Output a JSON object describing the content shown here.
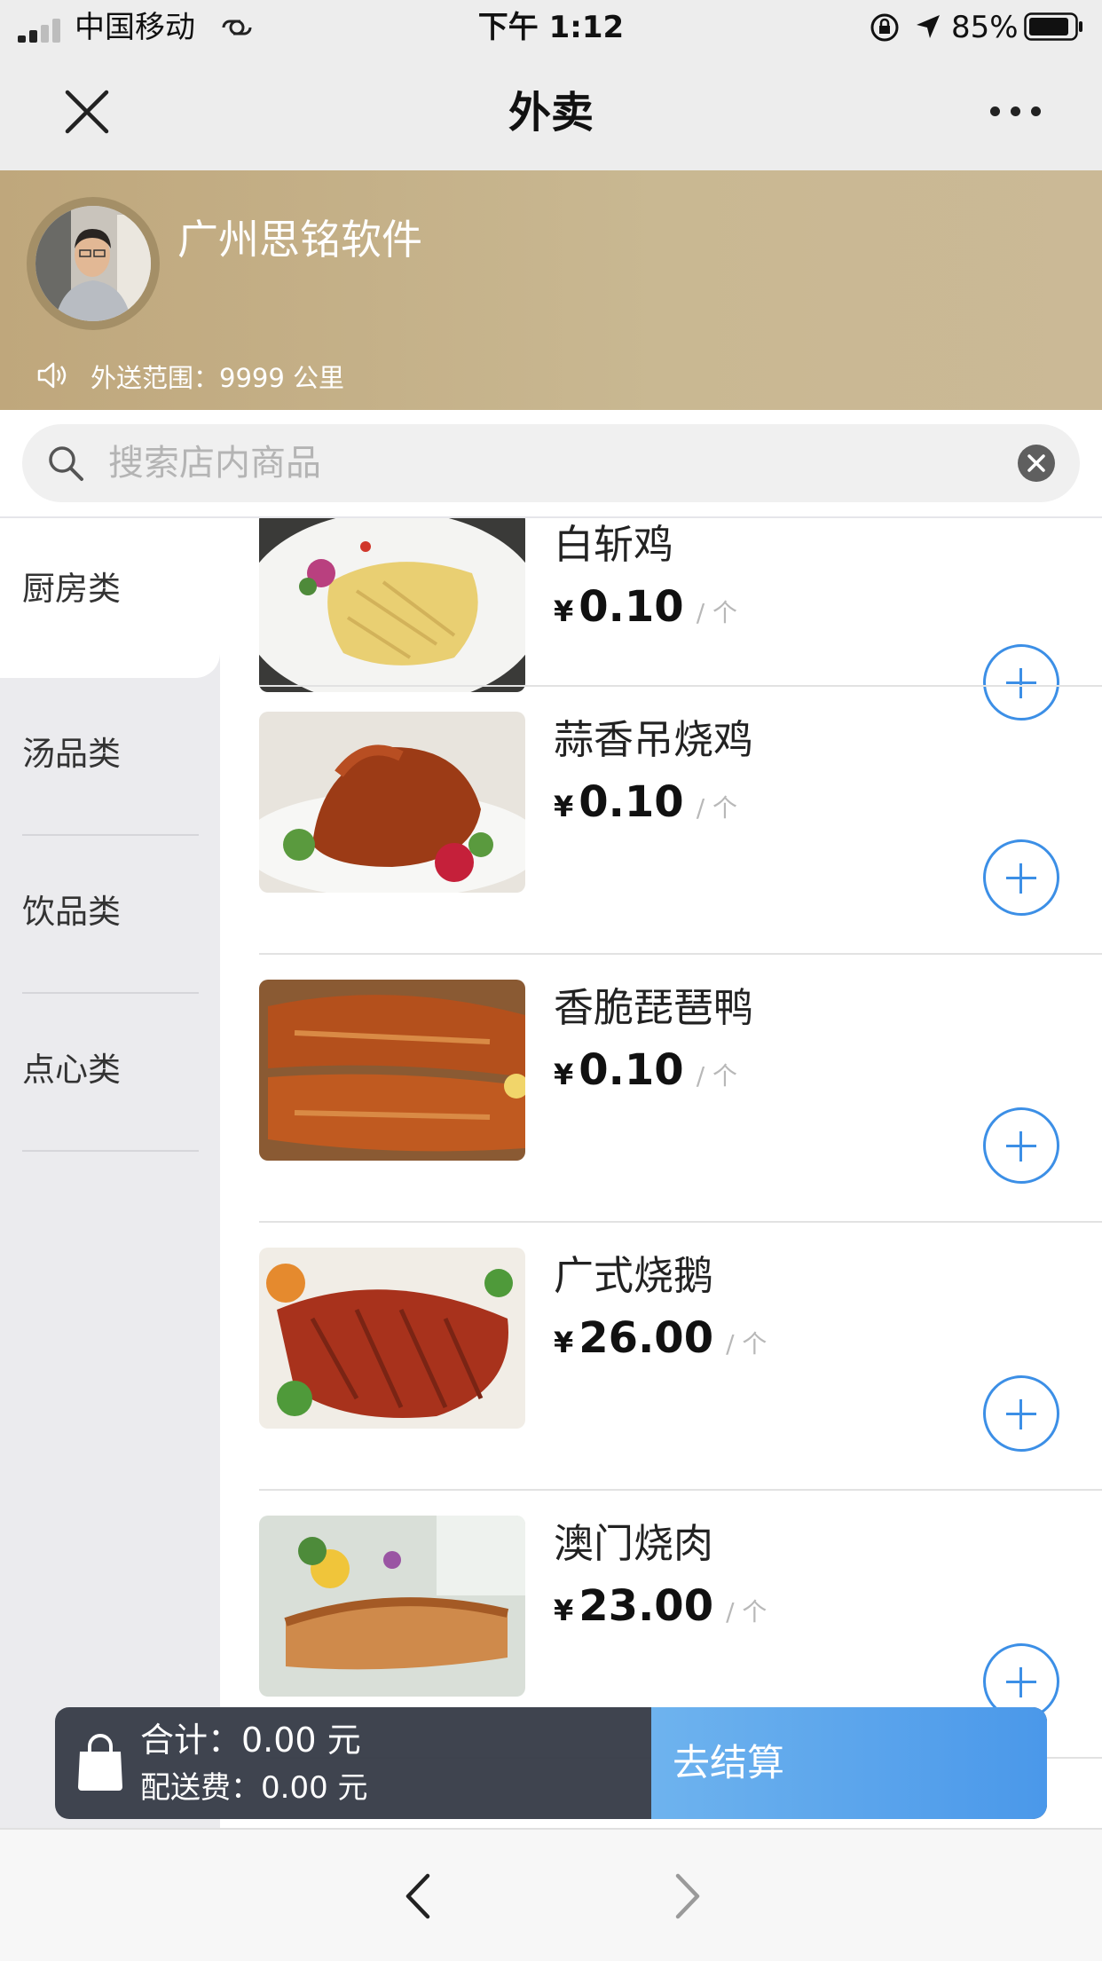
{
  "status_bar": {
    "carrier": "中国移动",
    "time": "下午 1:12",
    "battery": "85%"
  },
  "nav": {
    "title": "外卖",
    "close_icon": "close-icon",
    "more_icon": "more-icon"
  },
  "store": {
    "name": "广州思铭软件",
    "delivery_range": "外送范围：9999 公里"
  },
  "search": {
    "placeholder": "搜索店内商品"
  },
  "categories": [
    {
      "label": "厨房类",
      "active": true
    },
    {
      "label": "汤品类",
      "active": false
    },
    {
      "label": "饮品类",
      "active": false
    },
    {
      "label": "点心类",
      "active": false
    }
  ],
  "products": [
    {
      "name": "白斩鸡",
      "currency": "¥",
      "price": "0.10",
      "unit": "/ 个"
    },
    {
      "name": "蒜香吊烧鸡",
      "currency": "¥",
      "price": "0.10",
      "unit": "/ 个"
    },
    {
      "name": "香脆琵琶鸭",
      "currency": "¥",
      "price": "0.10",
      "unit": "/ 个"
    },
    {
      "name": "广式烧鹅",
      "currency": "¥",
      "price": "26.00",
      "unit": "/ 个"
    },
    {
      "name": "澳门烧肉",
      "currency": "¥",
      "price": "23.00",
      "unit": "/ 个"
    }
  ],
  "cart": {
    "total": "合计：0.00 元",
    "delivery_fee": "配送费：0.00 元",
    "checkout_label": "去结算"
  },
  "colors": {
    "accent": "#3c8fe6",
    "banner": "#c6b48d",
    "sidebar": "#ebebee"
  }
}
